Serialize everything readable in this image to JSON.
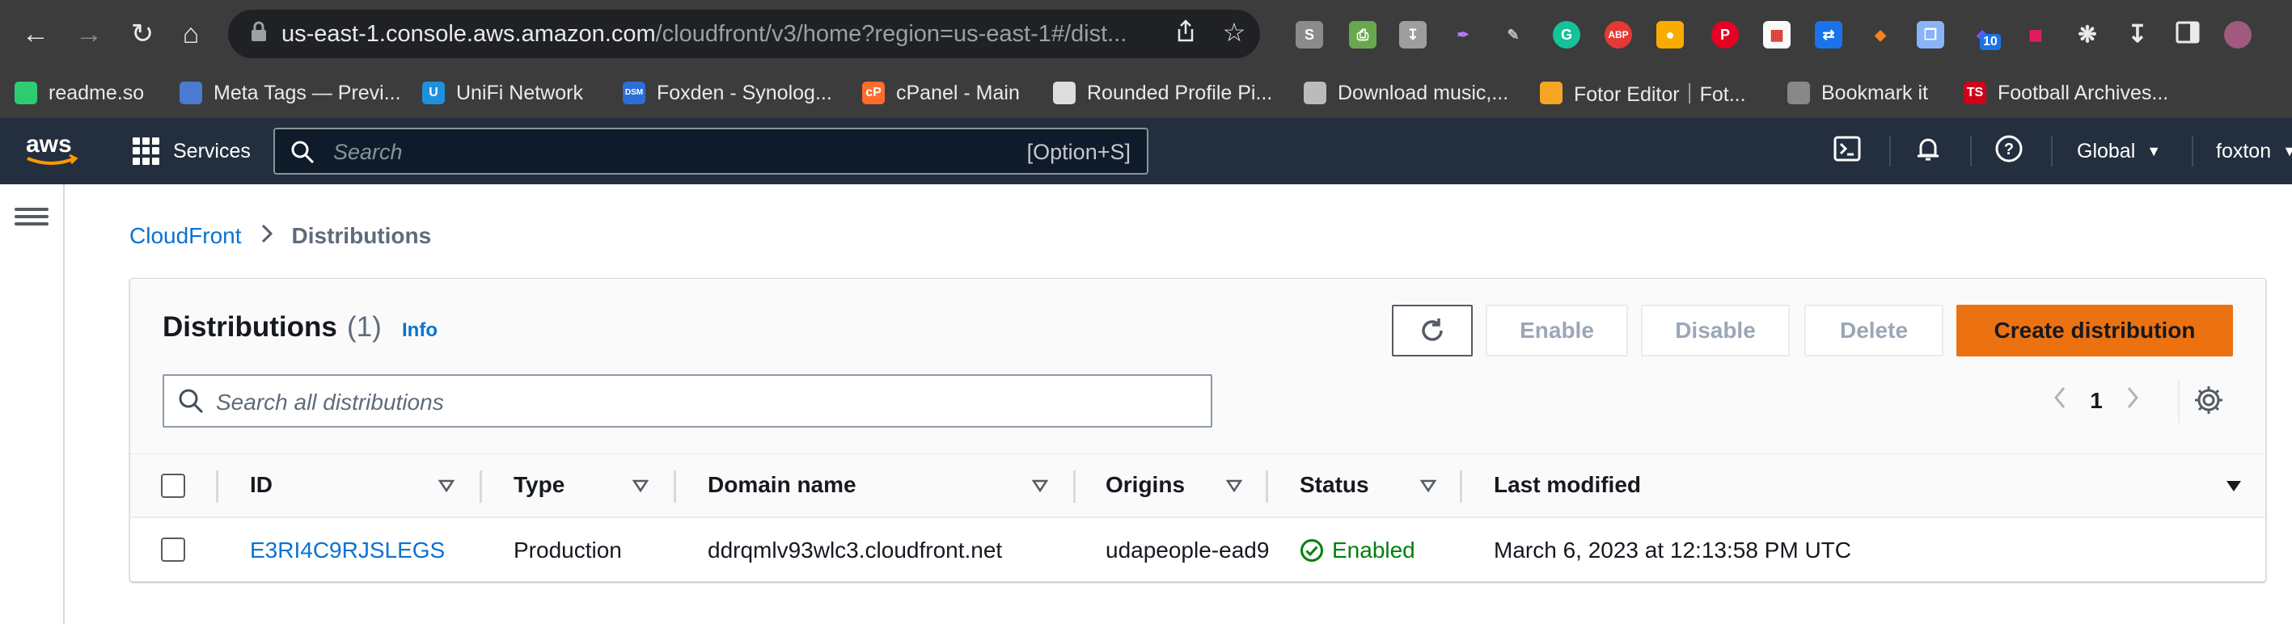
{
  "browser": {
    "url_host": "us-east-1.console.aws.amazon.com",
    "url_path": "/cloudfront/v3/home?region=us-east-1#/dist...",
    "extension_labels": {
      "abp": "ABP",
      "badge": "10"
    },
    "bookmarks": [
      {
        "label": "readme.so",
        "icon": "readme-icon",
        "color": "#2ecc71"
      },
      {
        "label": "Meta Tags — Previ...",
        "icon": "meta-tags-icon",
        "color": "#4a7bd0"
      },
      {
        "label": "UniFi Network",
        "icon": "unifi-icon",
        "color": "#1f8fe0",
        "glyph": "U"
      },
      {
        "label": "Foxden - Synolog...",
        "icon": "synology-dsm-icon",
        "color": "#2b6fd6",
        "glyph": "DSM"
      },
      {
        "label": "cPanel - Main",
        "icon": "cpanel-icon",
        "color": "#ff6c2c",
        "glyph": "cP"
      },
      {
        "label": "Rounded Profile Pi...",
        "icon": "profile-icon",
        "color": "#dddddd"
      },
      {
        "label": "Download music,...",
        "icon": "download-music-icon",
        "color": "#bbbbbb"
      },
      {
        "label": "Fotor Editor｜Fot...",
        "icon": "fotor-icon",
        "color": "#f5a623"
      },
      {
        "label": "Bookmark it",
        "icon": "globe-icon",
        "color": "#888888"
      },
      {
        "label": "Football Archives...",
        "icon": "ts-icon",
        "color": "#d0021b",
        "glyph": "TS"
      }
    ]
  },
  "aws_nav": {
    "services_label": "Services",
    "search_placeholder": "Search",
    "search_shortcut": "[Option+S]",
    "region_label": "Global",
    "user_label": "foxton"
  },
  "breadcrumb": {
    "root": "CloudFront",
    "current": "Distributions"
  },
  "panel": {
    "title": "Distributions",
    "count": "(1)",
    "info_label": "Info",
    "buttons": {
      "enable": "Enable",
      "disable": "Disable",
      "delete": "Delete",
      "create": "Create distribution"
    },
    "search_placeholder": "Search all distributions",
    "page": "1"
  },
  "table": {
    "columns": [
      "ID",
      "Type",
      "Domain name",
      "Origins",
      "Status",
      "Last modified"
    ],
    "rows": [
      {
        "id": "E3RI4C9RJSLEGS",
        "type": "Production",
        "domain": "ddrqmlv93wlc3.cloudfront.net",
        "origins": "udapeople-ead9",
        "status": "Enabled",
        "last_modified": "March 6, 2023 at 12:13:58 PM UTC"
      }
    ]
  },
  "colors": {
    "aws_nav_bg": "#232f3e",
    "primary_button": "#ec7211",
    "link": "#0972d3",
    "status_ok": "#037f0c"
  }
}
